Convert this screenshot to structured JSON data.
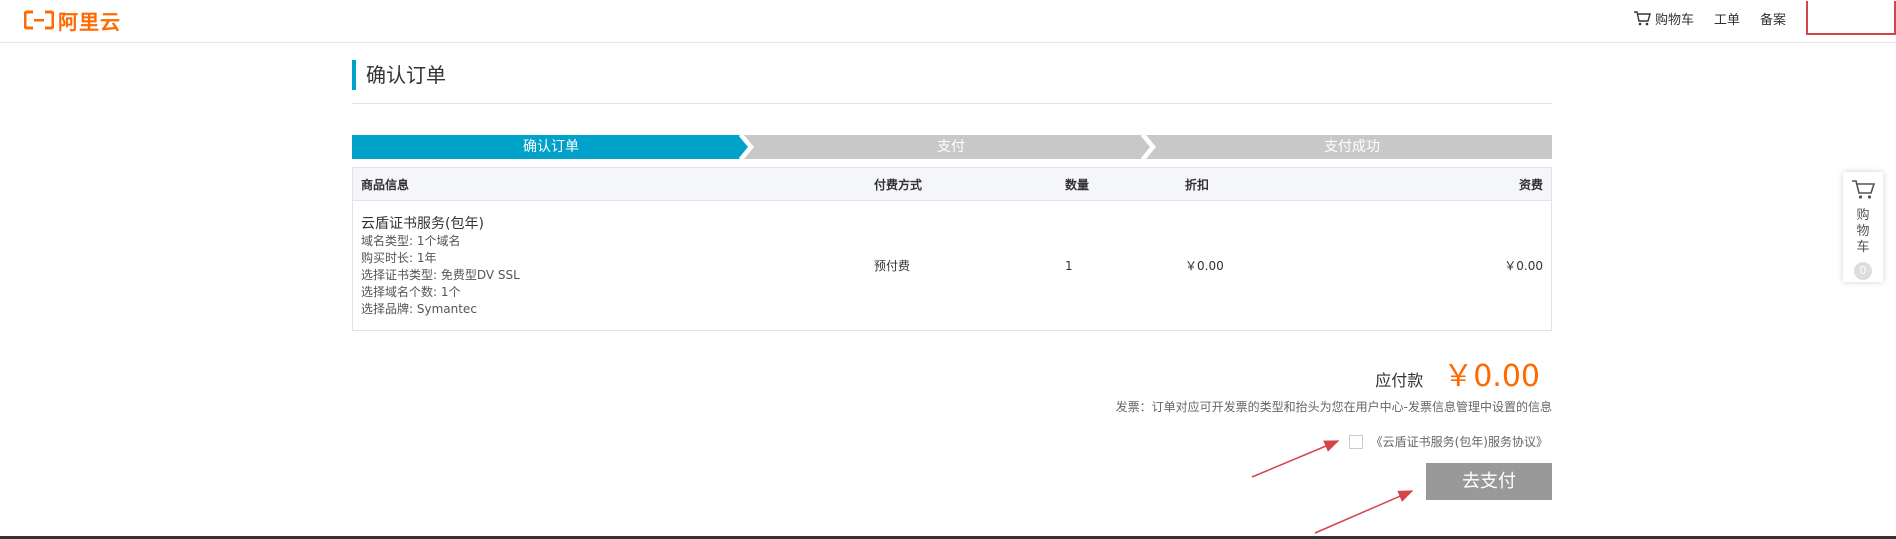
{
  "header": {
    "logo_text": "阿里云",
    "nav": {
      "cart": "购物车",
      "ticket": "工单",
      "filing": "备案"
    }
  },
  "page": {
    "title": "确认订单"
  },
  "steps": [
    {
      "label": "确认订单",
      "active": true
    },
    {
      "label": "支付",
      "active": false
    },
    {
      "label": "支付成功",
      "active": false
    }
  ],
  "table": {
    "headers": {
      "product": "商品信息",
      "pay_method": "付费方式",
      "quantity": "数量",
      "discount": "折扣",
      "fee": "资费"
    },
    "rows": [
      {
        "name": "云盾证书服务(包年)",
        "details": [
          "域名类型: 1个域名",
          "购买时长: 1年",
          "选择证书类型: 免费型DV SSL",
          "选择域名个数: 1个",
          "选择品牌: Symantec"
        ],
        "pay_method": "预付费",
        "quantity": "1",
        "discount": "￥0.00",
        "fee": "￥0.00"
      }
    ]
  },
  "summary": {
    "amount_label": "应付款",
    "amount_value": "￥0.00",
    "invoice_note": "发票：订单对应可开发票的类型和抬头为您在用户中心-发票信息管理中设置的信息",
    "agreement": "《云盾证书服务(包年)服务协议》",
    "pay_button": "去支付"
  },
  "float_cart": {
    "label": "购物车",
    "count": "0"
  },
  "colors": {
    "brand": "#ff6a00",
    "step_active": "#00a2ca",
    "step_inactive": "#c8c8c8",
    "annotation_red": "#d7434a"
  }
}
